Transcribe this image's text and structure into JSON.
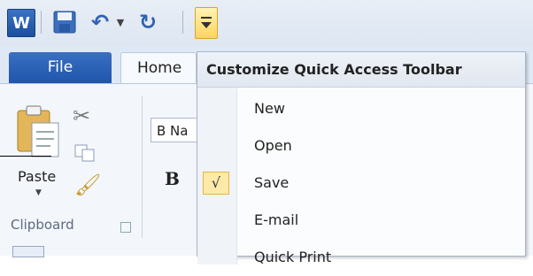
{
  "app": {
    "icon_letter": "W"
  },
  "tabs": {
    "file": "File",
    "home": "Home"
  },
  "clipboard": {
    "paste_label": "Paste",
    "group_label": "Clipboard"
  },
  "font": {
    "name_value": "B Na",
    "bold_label": "B"
  },
  "menu": {
    "title": "Customize Quick Access Toolbar",
    "items": [
      {
        "label": "New",
        "checked": false
      },
      {
        "label": "Open",
        "checked": false
      },
      {
        "label": "Save",
        "checked": true,
        "check_glyph": "√"
      },
      {
        "label": "E-mail",
        "checked": false
      },
      {
        "label": "Quick Print",
        "checked": false
      }
    ]
  },
  "colors": {
    "accent": "#1f56ab",
    "highlight": "#ffd45e"
  }
}
